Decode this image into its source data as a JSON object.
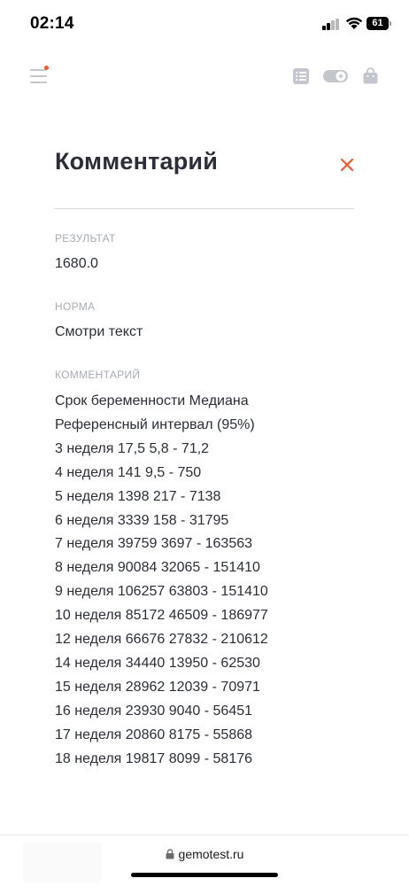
{
  "status_bar": {
    "time": "02:14",
    "battery": "61"
  },
  "header": {
    "icons": [
      "menu-icon",
      "list-icon",
      "toggle-icon",
      "bag-icon"
    ],
    "notification_color": "#ef5a2f"
  },
  "modal": {
    "title": "Комментарий",
    "close_icon": "close-icon",
    "close_color": "#ef5a2f",
    "result_label": "РЕЗУЛЬТАТ",
    "result_value": "1680.0",
    "norm_label": "НОРМА",
    "norm_value": "Смотри текст",
    "comment_label": "КОММЕНТАРИЙ",
    "comment_lines": [
      "Срок беременности Медиана",
      "Референсный интервал (95%)",
      "3 неделя 17,5 5,8 - 71,2",
      "4 неделя 141 9,5 - 750",
      "5 неделя 1398 217 - 7138",
      "6 неделя 3339 158 - 31795",
      "7 неделя 39759 3697 - 163563",
      "8 неделя 90084 32065 - 151410",
      "9 неделя 106257 63803 - 151410",
      "10 неделя 85172 46509 - 186977",
      "12 неделя 66676 27832 - 210612",
      "14 неделя 34440 13950 - 62530",
      "15 неделя 28962 12039 - 70971",
      "16 неделя 23930 9040 - 56451",
      "17 неделя 20860 8175 - 55868",
      "18 неделя 19817 8099 - 58176"
    ]
  },
  "browser": {
    "url": "gemotest.ru"
  }
}
